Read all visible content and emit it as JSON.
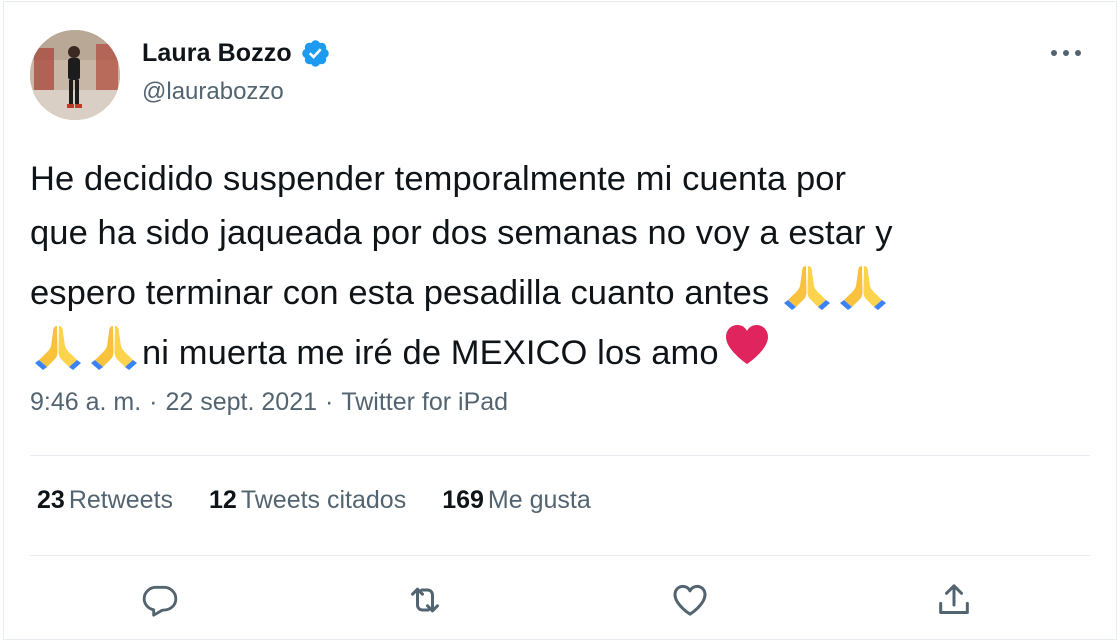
{
  "author": {
    "name": "Laura Bozzo",
    "handle": "@laurabozzo",
    "verified": true
  },
  "tweet": {
    "line1": "He decidido suspender temporalmente mi cuenta por",
    "line2": "que ha sido jaqueada por dos semanas no voy a estar y",
    "line3": "espero terminar con esta pesadilla cuanto antes ",
    "line4_text": "ni muerta me iré de MEXICO los amo"
  },
  "meta": {
    "time": "9:46 a. m.",
    "separator1": "·",
    "date": "22 sept. 2021",
    "separator2": "·",
    "source": "Twitter for iPad"
  },
  "stats": {
    "retweets_count": "23",
    "retweets_label": "Retweets",
    "quotes_count": "12",
    "quotes_label": "Tweets citados",
    "likes_count": "169",
    "likes_label": "Me gusta"
  },
  "icons": {
    "verified": "verified-badge-icon",
    "more": "more-icon",
    "reply": "reply-icon",
    "retweet": "retweet-icon",
    "like": "heart-icon",
    "share": "share-icon",
    "pray_emoji": "folded-hands-emoji",
    "heart_emoji": "red-heart-emoji"
  },
  "colors": {
    "verified_blue": "#1d9bf0",
    "secondary_text": "#536471",
    "primary_text": "#0f1419",
    "heart_red": "#e0245e"
  }
}
